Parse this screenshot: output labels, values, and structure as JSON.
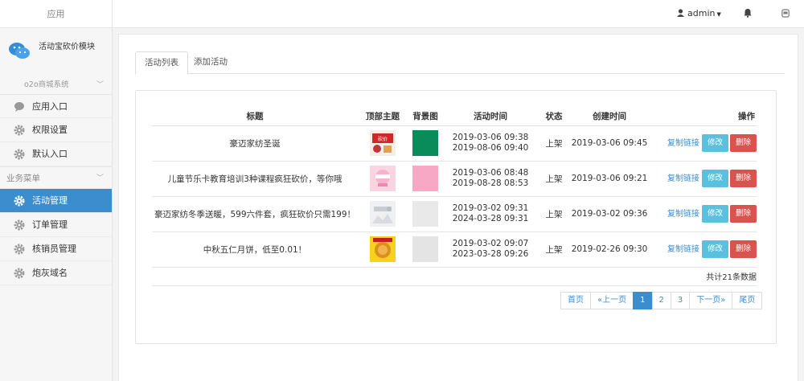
{
  "sidebar": {
    "top_label": "应用",
    "app_name": "活动宝砍价模块",
    "shop_system": "o2o商城系统",
    "items_top": [
      {
        "label": "应用入口",
        "icon": "chat-bubble-icon"
      },
      {
        "label": "权限设置",
        "icon": "gear-icon"
      },
      {
        "label": "默认入口",
        "icon": "gear-icon"
      }
    ],
    "section_label": "业务菜单",
    "items_biz": [
      {
        "label": "活动管理",
        "icon": "gear-icon",
        "active": true
      },
      {
        "label": "订单管理",
        "icon": "gear-icon"
      },
      {
        "label": "核销员管理",
        "icon": "gear-icon"
      },
      {
        "label": "炮灰域名",
        "icon": "gear-icon"
      }
    ]
  },
  "header": {
    "user": "admin"
  },
  "tabs": [
    "活动列表",
    "添加活动"
  ],
  "table": {
    "columns": [
      "标题",
      "顶部主题",
      "背景图",
      "活动时间",
      "状态",
      "创建时间",
      "操作"
    ],
    "rows": [
      {
        "title": "豪迈家纺圣诞",
        "start": "2019-03-06 09:38",
        "end": "2019-08-06 09:40",
        "status": "上架",
        "created": "2019-03-06 09:45",
        "bg_color": "#0a8c5a"
      },
      {
        "title": "儿童节乐卡教育培训3种课程疯狂砍价，等你哦",
        "start": "2019-03-06 08:48",
        "end": "2019-08-28 08:53",
        "status": "上架",
        "created": "2019-03-06 09:21",
        "bg_color": "#f7a8c4"
      },
      {
        "title": "豪迈家纺冬季送暖，599六件套，疯狂砍价只需199！",
        "start": "2019-03-02 09:31",
        "end": "2024-03-28 09:31",
        "status": "上架",
        "created": "2019-03-02 09:36",
        "bg_color": "#e9e9e9"
      },
      {
        "title": "中秋五仁月饼，低至0.01！",
        "start": "2019-03-02 09:07",
        "end": "2023-03-28 09:26",
        "status": "上架",
        "created": "2019-02-26 09:30",
        "bg_color": "#e4e4e4"
      }
    ],
    "op_copy": "复制链接",
    "op_edit": "修改",
    "op_delete": "删除",
    "total": "共计21条数据"
  },
  "pager": [
    "首页",
    "«上一页",
    "1",
    "2",
    "3",
    "下一页»",
    "尾页"
  ],
  "colors": {
    "accent": "#3c8dce",
    "edit": "#5bc0de",
    "delete": "#d9534f"
  }
}
